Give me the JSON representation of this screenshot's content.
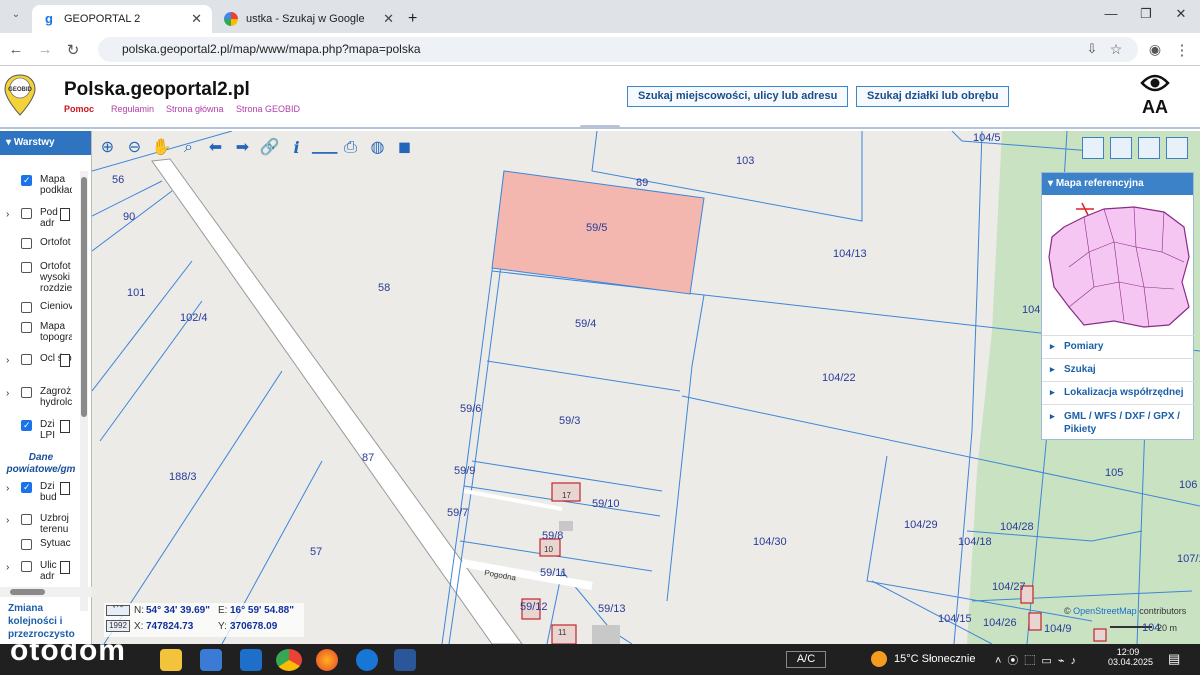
{
  "browser": {
    "tabs": [
      {
        "label": "GEOPORTAL 2",
        "active": true
      },
      {
        "label": "ustka - Szukaj w Google",
        "active": false
      }
    ],
    "new_tab": "+",
    "url": "polska.geoportal2.pl/map/www/mapa.php?mapa=polska"
  },
  "header": {
    "logo_text": "GEOBID",
    "title": "Polska.geoportal2.pl",
    "links": [
      "Pomoc",
      "Regulamin",
      "Strona główna",
      "Strona GEOBID"
    ],
    "search_place": "Szukaj miejscowości, ulicy lub adresu",
    "search_parcel": "Szukaj działki lub obrębu",
    "font_size_label": "AA"
  },
  "layers": {
    "title": "Warstwy",
    "items": [
      {
        "label": "Mapa podkład",
        "checked": true,
        "expander": false,
        "doc": false
      },
      {
        "label": "Pod adr",
        "checked": false,
        "expander": true,
        "doc": true
      },
      {
        "label": "Ortofot",
        "checked": false,
        "expander": false,
        "doc": false
      },
      {
        "label": "Ortofot wysoki rozdzie",
        "checked": false,
        "expander": false,
        "doc": false
      },
      {
        "label": "Cieniov",
        "checked": false,
        "expander": false,
        "doc": false
      },
      {
        "label": "Mapa topogra",
        "checked": false,
        "expander": false,
        "doc": false
      },
      {
        "label": "Ocl śro",
        "checked": false,
        "expander": true,
        "doc": true
      },
      {
        "label": "Zagroż hydrolc",
        "checked": false,
        "expander": true,
        "doc": false
      },
      {
        "label": "Dzi LPI",
        "checked": true,
        "expander": false,
        "doc": true
      },
      {
        "label": "Dzi bud",
        "checked": true,
        "expander": true,
        "doc": true
      },
      {
        "label": "Uzbroj terenu",
        "checked": false,
        "expander": true,
        "doc": false
      },
      {
        "label": "Sytuac",
        "checked": false,
        "expander": false,
        "doc": false
      },
      {
        "label": "Ulic adr",
        "checked": false,
        "expander": true,
        "doc": true
      }
    ],
    "group_label": "Dane powiatowe/gm",
    "footer_link": "Zmiana kolejności i przezroczysto"
  },
  "map": {
    "parcels": [
      "59/5",
      "59/4",
      "59/3",
      "59/6",
      "59/9",
      "59/10",
      "59/7",
      "59/8",
      "59/11",
      "59/12",
      "59/13",
      "58",
      "57",
      "56",
      "90",
      "101",
      "102/4",
      "188/3",
      "87",
      "89",
      "103",
      "104/5",
      "104/13",
      "104/22",
      "104/29",
      "104/30",
      "104/18",
      "104/28",
      "104/27",
      "104/26",
      "104/15",
      "104/9",
      "104",
      "105",
      "106",
      "107/1",
      "104"
    ],
    "building_labels": [
      "17",
      "10",
      "11"
    ],
    "street": "Pogodna",
    "attribution_prefix": "©",
    "attribution_link": "OpenStreetMap",
    "attribution_suffix": "contributors",
    "scale": "20 m",
    "highlight_color": "#f3b7b0"
  },
  "coords": {
    "geo_label": "° ' \"",
    "n_label": "N:",
    "n_value": "54° 34' 39.69\"",
    "e_label": "E:",
    "e_value": "16° 59' 54.88\"",
    "sys_label": "1992",
    "x_label": "X:",
    "x_value": "747824.73",
    "y_label": "Y:",
    "y_value": "370678.09"
  },
  "right_panel": {
    "title": "Mapa referencyjna",
    "items": [
      "Pomiary",
      "Szukaj",
      "Lokalizacja współrzędnej",
      "GML / WFS / DXF / GPX / Pikiety"
    ]
  },
  "taskbar": {
    "ac": "A/C",
    "weather": "15°C Słonecznie",
    "time": "12:09",
    "date": "03.04.2025"
  },
  "watermark": "otodom"
}
